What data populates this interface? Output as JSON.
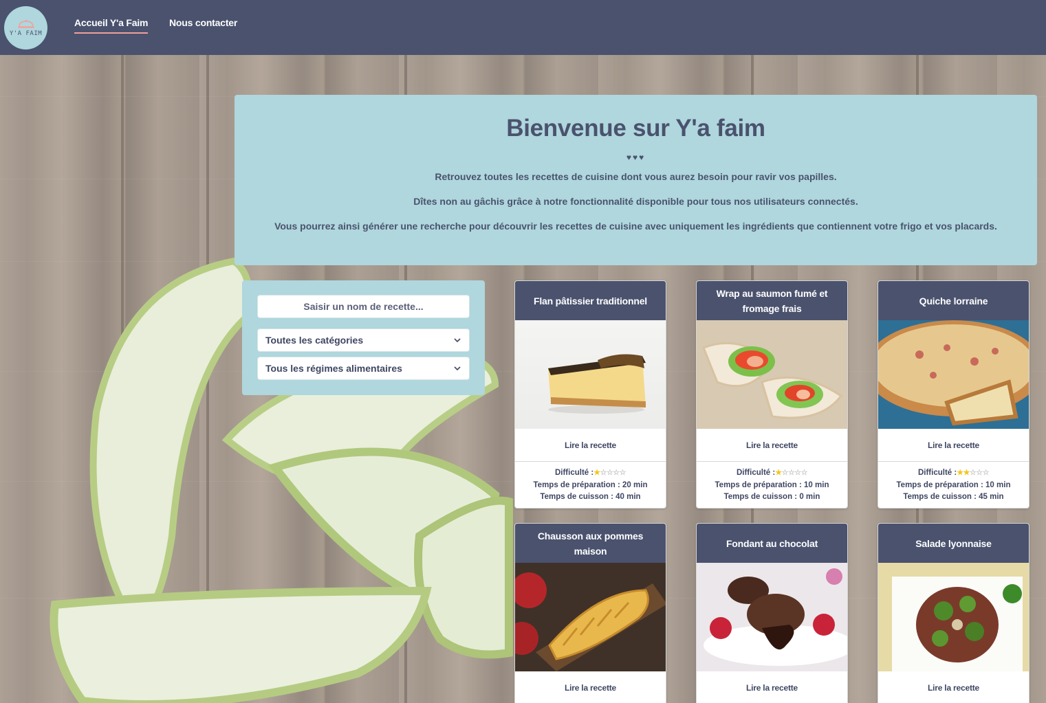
{
  "nav": {
    "logo_text": "Y'A FAIM",
    "links": [
      {
        "label": "Accueil Y'a Faim",
        "active": true
      },
      {
        "label": "Nous contacter",
        "active": false
      }
    ]
  },
  "hero": {
    "title": "Bienvenue sur Y'a faim",
    "hearts": "♥♥♥",
    "paragraphs": [
      "Retrouvez toutes les recettes de cuisine dont vous aurez besoin pour ravir vos papilles.",
      "Dîtes non au gâchis grâce à notre fonctionnalité disponible pour tous nos utilisateurs connectés.",
      "Vous pourrez ainsi générer une recherche pour découvrir les recettes de cuisine avec uniquement les ingrédients que contiennent votre frigo et vos placards."
    ]
  },
  "search": {
    "placeholder": "Saisir un nom de recette...",
    "category_select": "Toutes les catégories",
    "diet_select": "Tous les régimes alimentaires"
  },
  "colors": {
    "navbar": "#4a526e",
    "hero_bg": "#afd7dd",
    "accent_underline": "#f2a09a",
    "star": "#f5c518"
  },
  "card_labels": {
    "read": "Lire la recette",
    "difficulty": "Difficulté :",
    "prep": "Temps de préparation :",
    "cook": "Temps de cuisson :"
  },
  "recipes": [
    {
      "title": "Flan pâtissier traditionnel",
      "difficulty": 1,
      "prep": "20 min",
      "cook": "40 min",
      "image": "flan-image"
    },
    {
      "title": "Wrap au saumon fumé et fromage frais",
      "difficulty": 1,
      "prep": "10 min",
      "cook": "0 min",
      "image": "wrap-image"
    },
    {
      "title": "Quiche lorraine",
      "difficulty": 2,
      "prep": "10 min",
      "cook": "45 min",
      "image": "quiche-image"
    },
    {
      "title": "Chausson aux pommes maison",
      "image": "chausson-image"
    },
    {
      "title": "Fondant au chocolat",
      "image": "fondant-image"
    },
    {
      "title": "Salade lyonnaise",
      "image": "salade-image"
    }
  ]
}
